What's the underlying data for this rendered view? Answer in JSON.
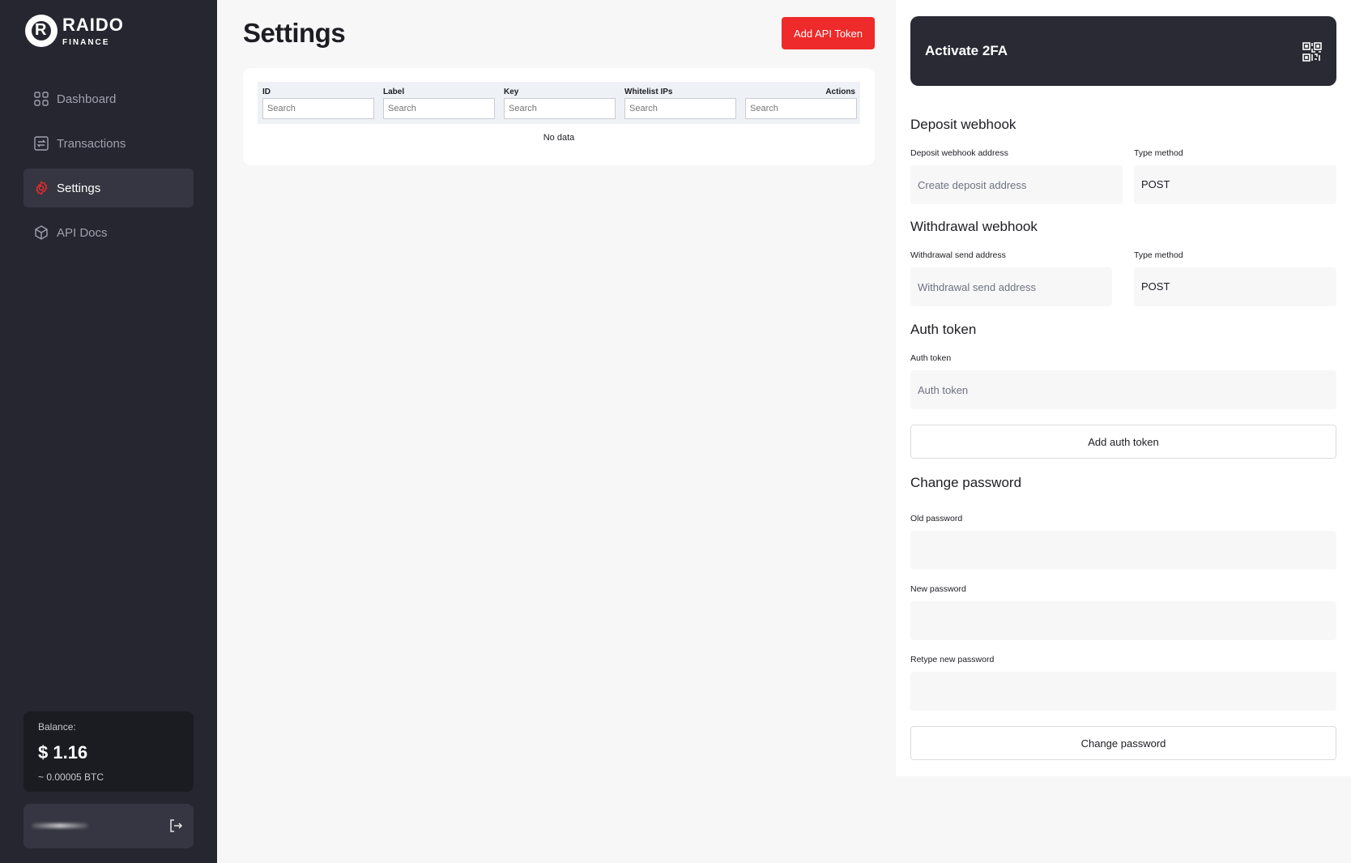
{
  "brand": {
    "name": "RAIDO",
    "sub": "FINANCE"
  },
  "nav": {
    "items": [
      {
        "label": "Dashboard",
        "icon": "dashboard-grid-icon"
      },
      {
        "label": "Transactions",
        "icon": "transactions-icon"
      },
      {
        "label": "Settings",
        "icon": "gear-icon",
        "active": true
      },
      {
        "label": "API Docs",
        "icon": "cube-icon"
      }
    ]
  },
  "balance": {
    "label": "Balance:",
    "value": "$ 1.16",
    "btc": "~ 0.00005 BTC"
  },
  "page": {
    "title": "Settings",
    "add_token_label": "Add API Token"
  },
  "table": {
    "columns": [
      "ID",
      "Label",
      "Key",
      "Whitelist IPs"
    ],
    "actions_label": "Actions",
    "search_placeholder": "Search",
    "empty_text": "No data"
  },
  "twofa": {
    "title": "Activate 2FA"
  },
  "deposit": {
    "title": "Deposit webhook",
    "address_label": "Deposit webhook address",
    "address_placeholder": "Create deposit address",
    "method_label": "Type method",
    "method_value": "POST"
  },
  "withdrawal": {
    "title": "Withdrawal webhook",
    "address_label": "Withdrawal send address",
    "address_placeholder": "Withdrawal send address",
    "method_label": "Type method",
    "method_value": "POST"
  },
  "auth": {
    "title": "Auth token",
    "label": "Auth token",
    "placeholder": "Auth token",
    "button": "Add auth token"
  },
  "password": {
    "title": "Change password",
    "old_label": "Old password",
    "new_label": "New password",
    "retype_label": "Retype new password",
    "button": "Change password"
  },
  "colors": {
    "accent": "#ee2a2a",
    "sidebar": "#262630",
    "card_dark": "#2a2a35"
  }
}
